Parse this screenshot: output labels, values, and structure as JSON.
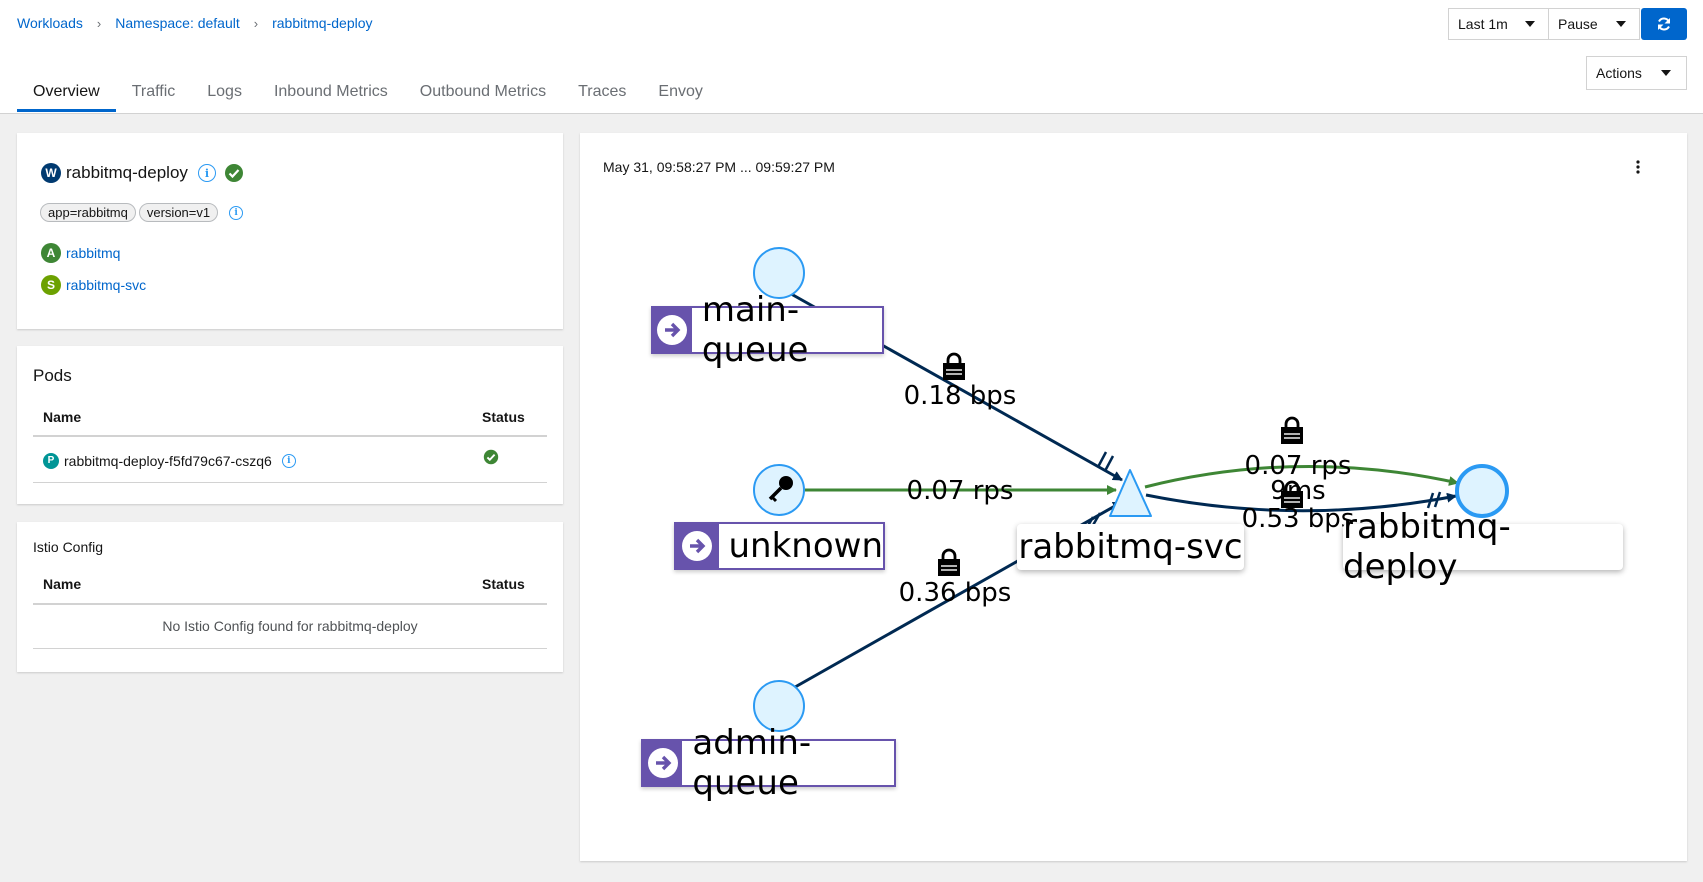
{
  "breadcrumb": [
    "Workloads",
    "Namespace: default",
    "rabbitmq-deploy"
  ],
  "toolbar": {
    "time_range": "Last 1m",
    "refresh_mode": "Pause",
    "actions": "Actions"
  },
  "tabs": [
    "Overview",
    "Traffic",
    "Logs",
    "Inbound Metrics",
    "Outbound Metrics",
    "Traces",
    "Envoy"
  ],
  "workload": {
    "badge": "W",
    "name": "rabbitmq-deploy",
    "labels": [
      "app=rabbitmq",
      "version=v1"
    ],
    "app": {
      "badge": "A",
      "name": "rabbitmq"
    },
    "service": {
      "badge": "S",
      "name": "rabbitmq-svc"
    }
  },
  "pods": {
    "title": "Pods",
    "col_name": "Name",
    "col_status": "Status",
    "rows": [
      {
        "badge": "P",
        "name": "rabbitmq-deploy-f5fd79c67-cszq6"
      }
    ]
  },
  "istio": {
    "title": "Istio Config",
    "col_name": "Name",
    "col_status": "Status",
    "empty": "No Istio Config found for rabbitmq-deploy"
  },
  "graph": {
    "time_range": "May 31, 09:58:27 PM ... 09:59:27 PM",
    "nodes": {
      "main": "main-queue",
      "unknown": "unknown",
      "svc": "rabbitmq-svc",
      "deploy": "rabbitmq-deploy",
      "admin": "admin-queue"
    },
    "edges": {
      "main_svc": "0.18 bps",
      "unknown_svc": "0.07 rps",
      "admin_svc": "0.36 bps",
      "svc_deploy_http_rps": "0.07 rps",
      "svc_deploy_http_ms": "9ms",
      "svc_deploy_tcp": "0.53 bps"
    }
  },
  "colors": {
    "accent": "#0066cc",
    "http_edge": "#3e8635",
    "tcp_edge": "#002952",
    "node_fill": "#def3ff",
    "node_border": "#2b9af3",
    "node_badge": "#6753ac",
    "success": "#3e8635"
  }
}
